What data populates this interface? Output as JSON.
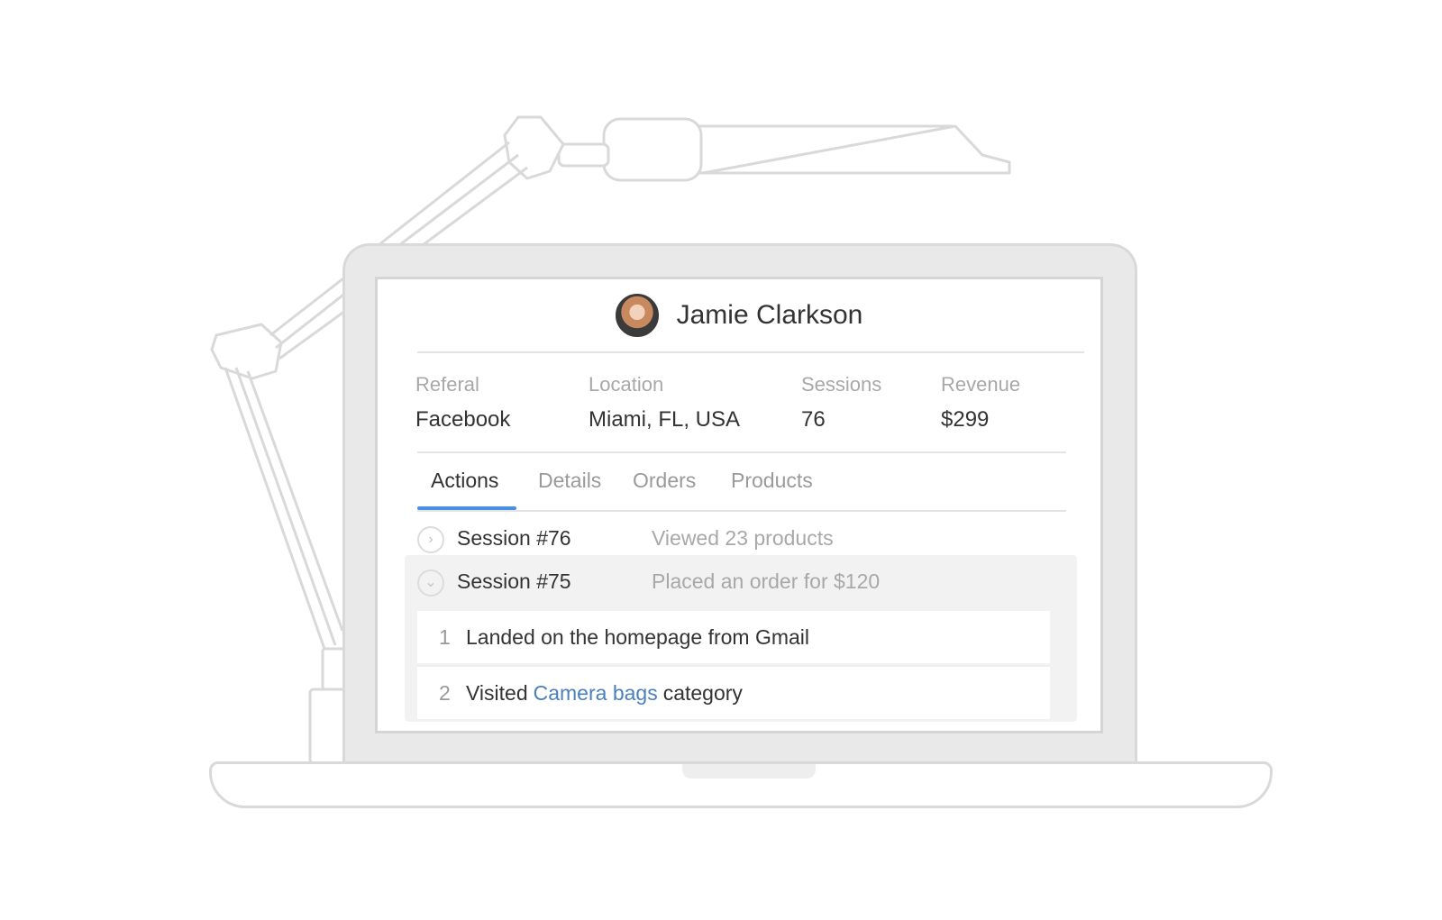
{
  "profile": {
    "name": "Jamie Clarkson"
  },
  "stats": [
    {
      "label": "Referal",
      "value": "Facebook"
    },
    {
      "label": "Location",
      "value": "Miami, FL, USA"
    },
    {
      "label": "Sessions",
      "value": "76"
    },
    {
      "label": "Revenue",
      "value": "$299"
    }
  ],
  "tabs": [
    {
      "label": "Actions",
      "active": true
    },
    {
      "label": "Details",
      "active": false
    },
    {
      "label": "Orders",
      "active": false
    },
    {
      "label": "Products",
      "active": false
    }
  ],
  "sessions": [
    {
      "title": "Session #76",
      "summary": "Viewed 23 products",
      "expanded": false,
      "toggle_icon": "chevron-right-icon"
    },
    {
      "title": "Session #75",
      "summary": "Placed an order for $120",
      "expanded": true,
      "toggle_icon": "chevron-down-icon"
    }
  ],
  "actions": [
    {
      "index": "1",
      "text": "Landed on the homepage from Gmail"
    },
    {
      "index": "2",
      "text_before": "Visited",
      "link": "Camera bags",
      "text_after": "category"
    }
  ],
  "colors": {
    "accent": "#4a90e2",
    "link": "#4a7fc1",
    "muted_text": "#a8a8a8",
    "outline": "#d9d9d9"
  }
}
